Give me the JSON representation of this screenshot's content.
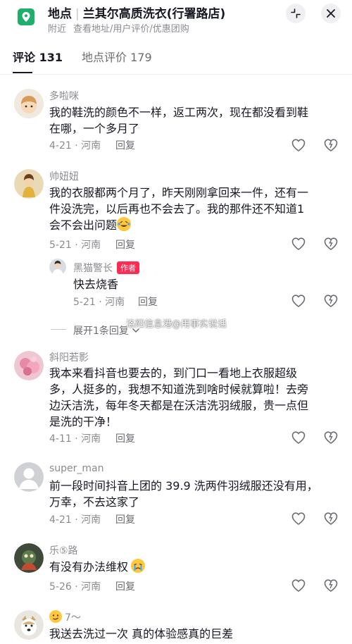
{
  "header": {
    "place_prefix": "地点",
    "place_name": "兰其尔高质洗衣(行署路店)",
    "distance": "附近",
    "subtitle": "查看地址/用户评价/优惠团购",
    "icons": [
      "location-pin-icon",
      "collapse-icon",
      "close-icon"
    ]
  },
  "tabs": {
    "comments": "评论 131",
    "place_rating": "地点评价 179"
  },
  "actions": {
    "reply_label": "回复"
  },
  "comments": [
    {
      "user": "多啦咪",
      "lines": [
        "我的鞋洗的颜色不一样，返工两次，现在都没看到鞋",
        "在哪，一个多月了"
      ],
      "date": "4-21",
      "region": "河南"
    },
    {
      "user": "帅妞妞",
      "lines": [
        "我的衣服都两个月了，昨天刚刚拿回来一件，还有一",
        "件没洗完，以后再也不会去了。我的那件还不知道1",
        "会不会出问题"
      ],
      "date": "5-21",
      "region": "河南",
      "trailing_emoji": "laughing-tears-emoji"
    },
    {
      "user": "斜阳若影",
      "lines": [
        "我本来看抖音也要去的，到门口一看地上衣服超级",
        "多，人挺多的，我想不知道洗到啥时候就算啦！去旁",
        "边沃洁洗，每年冬天都是在沃洁洗羽绒服，贵一点但",
        "是洗的干净！"
      ],
      "date": "4-11",
      "region": "河南"
    },
    {
      "user": "super_man",
      "lines": [
        "前一段时间抖音上团的 39.9 洗两件羽绒服还没有用，",
        "万幸，不去这家了"
      ],
      "date": "4-21",
      "region": "河南"
    },
    {
      "user": "乐⑤路",
      "lines": [
        "有没有办法维权"
      ],
      "date": "5-26",
      "region": "河南",
      "trailing_emoji": "crying-emoji"
    },
    {
      "user": "7～",
      "lines": [
        "我送去洗过一次 真的体验感真的巨差"
      ],
      "user_prefix_emoji": "smirk-emoji"
    }
  ],
  "sub_reply": {
    "user": "黑猫警长",
    "badge": "作者",
    "text": "快去烧香",
    "date": "5-21",
    "region": "河南"
  },
  "expand_label": "展开1条回复",
  "watermark": "洛阳信息港@用事实说话",
  "colors": {
    "accent": "#fe2c55",
    "location_green": "#1fae6b",
    "muted_text": "#8a8b91"
  }
}
